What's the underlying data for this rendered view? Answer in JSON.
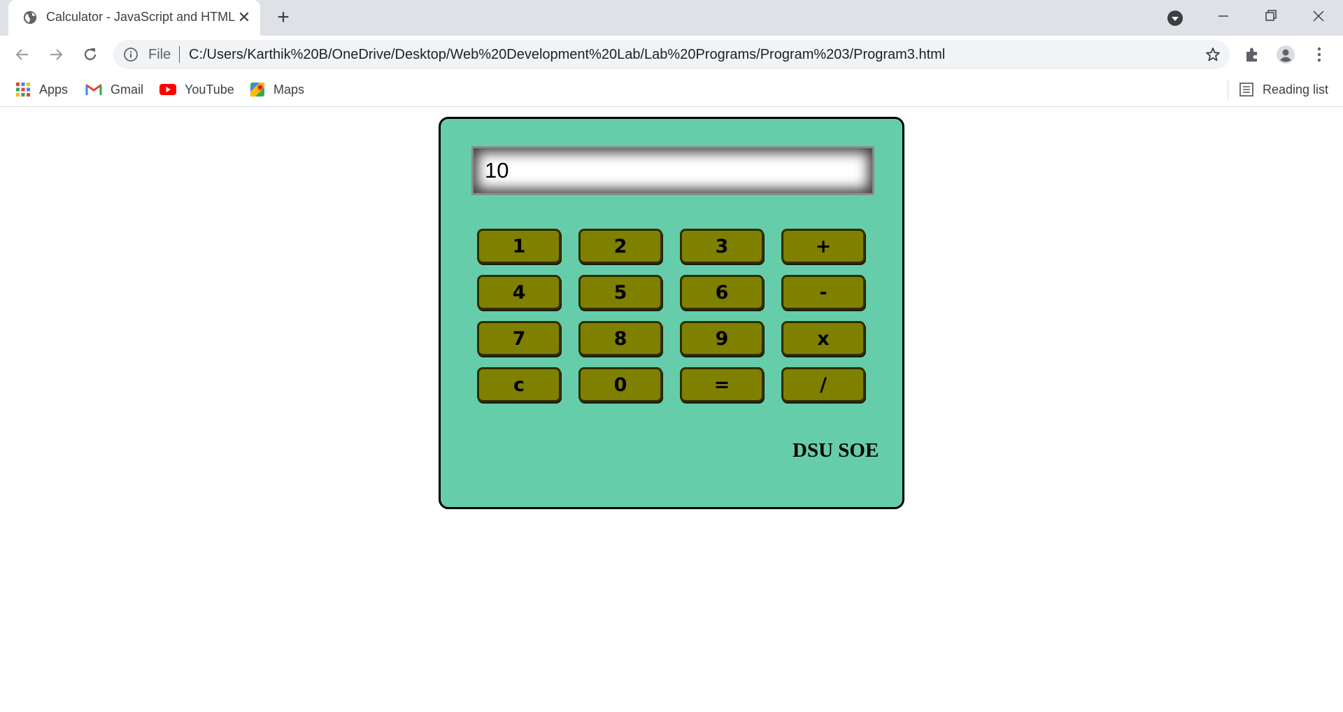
{
  "browser": {
    "tab_title": "Calculator - JavaScript and HTML",
    "omnibox": {
      "scheme_label": "File",
      "url": "C:/Users/Karthik%20B/OneDrive/Desktop/Web%20Development%20Lab/Lab%20Programs/Program%203/Program3.html"
    },
    "bookmarks": [
      {
        "label": "Apps",
        "icon": "apps-grid-icon"
      },
      {
        "label": "Gmail",
        "icon": "gmail-icon"
      },
      {
        "label": "YouTube",
        "icon": "youtube-icon"
      },
      {
        "label": "Maps",
        "icon": "maps-icon"
      }
    ],
    "reading_list_label": "Reading list"
  },
  "calculator": {
    "display_value": "10",
    "keys": [
      [
        "1",
        "2",
        "3",
        "+"
      ],
      [
        "4",
        "5",
        "6",
        "-"
      ],
      [
        "7",
        "8",
        "9",
        "x"
      ],
      [
        "c",
        "0",
        "=",
        "/"
      ]
    ],
    "brand": "DSU SOE",
    "colors": {
      "body": "#66cdaa",
      "key": "#808000",
      "border": "#000000"
    }
  }
}
